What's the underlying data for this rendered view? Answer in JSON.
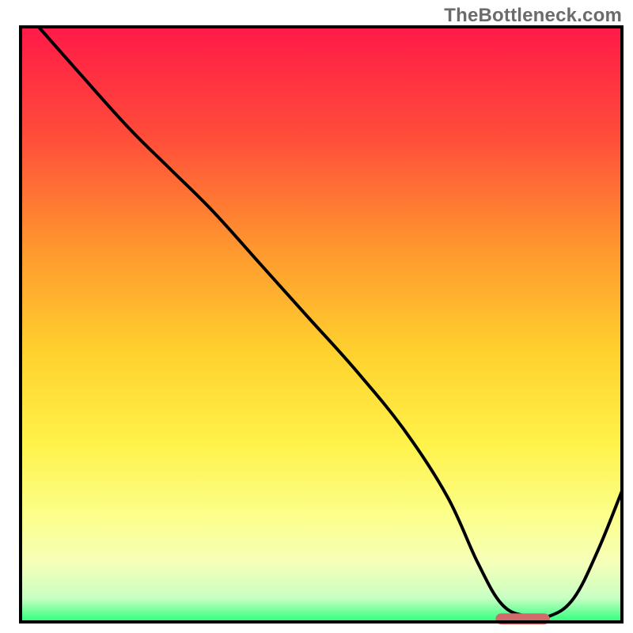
{
  "watermark": "TheBottleneck.com",
  "chart_data": {
    "type": "line",
    "title": "",
    "xlabel": "",
    "ylabel": "",
    "xlim": [
      0,
      100
    ],
    "ylim": [
      0,
      100
    ],
    "series": [
      {
        "name": "curve",
        "x": [
          3,
          10,
          18,
          25,
          32,
          40,
          48,
          56,
          64,
          71,
          76,
          80,
          84,
          88,
          92,
          96,
          100
        ],
        "y": [
          100,
          92,
          83,
          76,
          69,
          60,
          51,
          42,
          32,
          21,
          10,
          3,
          1,
          1,
          4,
          12,
          22
        ]
      }
    ],
    "marker": {
      "x_range": [
        79,
        88
      ],
      "y": 0.5,
      "color": "#d16a6a"
    },
    "gradient_stops": [
      {
        "offset": 0.0,
        "color": "#ff1a48"
      },
      {
        "offset": 0.18,
        "color": "#ff4b3a"
      },
      {
        "offset": 0.38,
        "color": "#ff9a2e"
      },
      {
        "offset": 0.55,
        "color": "#ffd22e"
      },
      {
        "offset": 0.7,
        "color": "#fff24a"
      },
      {
        "offset": 0.82,
        "color": "#fcff8a"
      },
      {
        "offset": 0.9,
        "color": "#f6ffb8"
      },
      {
        "offset": 0.96,
        "color": "#c8ffc3"
      },
      {
        "offset": 1.0,
        "color": "#2bff7b"
      }
    ],
    "frame_color": "#000000",
    "frame_width": 4
  }
}
